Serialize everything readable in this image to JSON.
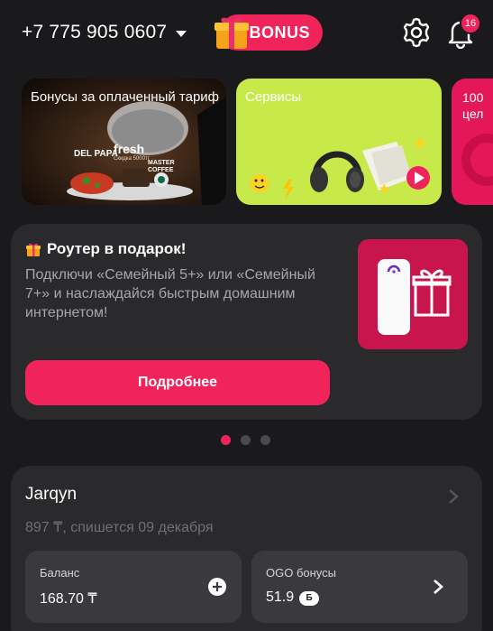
{
  "header": {
    "phone": "+7 775 905 0607",
    "bonus_label": "BONUS",
    "notifications_count": "16"
  },
  "carousel_cards": [
    {
      "title": "Бонусы за оплаченный тариф"
    },
    {
      "title": "Сервисы"
    },
    {
      "title": "100\nцел"
    }
  ],
  "card1_texts": {
    "brand1": "DEL PAPA",
    "brand2": "fresh",
    "brand3": "MASTER COFFEE",
    "small": "Скидка 5000тг"
  },
  "promo": {
    "title": "Роутер в подарок!",
    "text": "Подключи «Семейный 5+» или «Семейный 7+» и наслаждайся быстрым домашним интернетом!",
    "button_label": "Подробнее"
  },
  "pagination": {
    "active_index": 0,
    "count": 3
  },
  "account": {
    "name": "Jarqyn",
    "subtitle": "897 ₸, спишется 09 декабря",
    "balance_label": "Баланс",
    "balance_value": "168.70 ₸",
    "bonus_label": "OGO бонусы",
    "bonus_value": "51.9",
    "bonus_badge": "Б"
  },
  "colors": {
    "accent": "#f0245a",
    "background": "#1a1a1c",
    "card": "#2a2a2d",
    "tile": "#3a3a3e",
    "green": "#c7ea4a"
  }
}
